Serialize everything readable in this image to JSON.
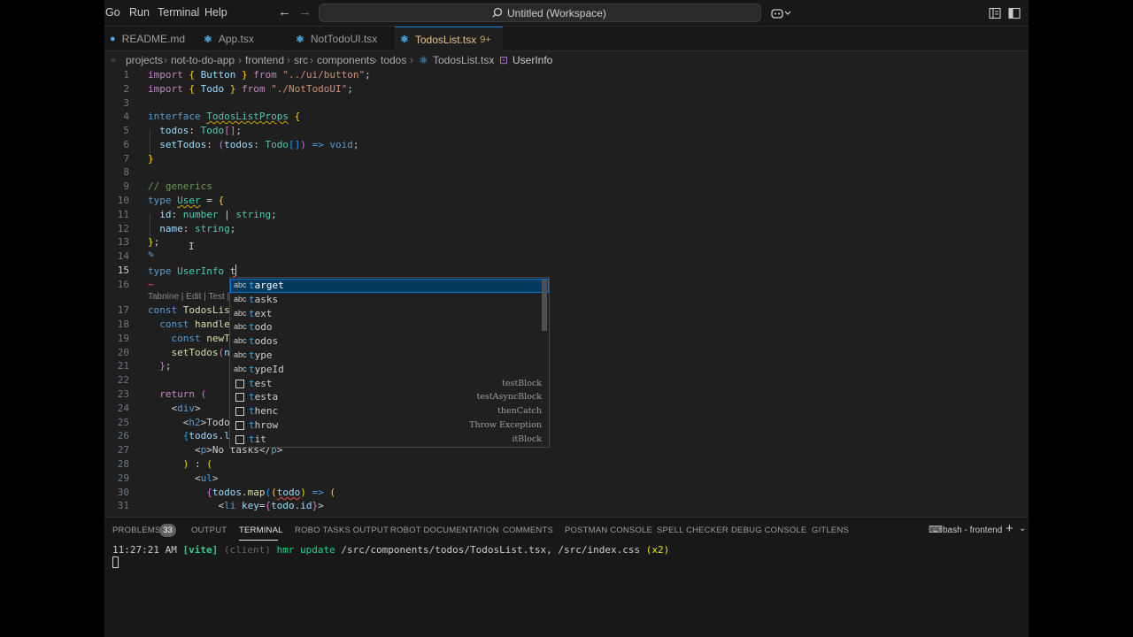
{
  "menu": [
    "Go",
    "Run",
    "Terminal",
    "Help"
  ],
  "command_center": "Untitled (Workspace)",
  "tabs": [
    {
      "label": "README.md",
      "icon": "info-icon",
      "color": "#4aa6e8"
    },
    {
      "label": "App.tsx",
      "icon": "react-icon",
      "color": "#4fc1ff"
    },
    {
      "label": "NotTodoUI.tsx",
      "icon": "react-icon",
      "color": "#4fc1ff"
    },
    {
      "label": "TodosList.tsx",
      "icon": "react-icon",
      "color": "#4fc1ff",
      "badge": "9+",
      "active": true,
      "dirty": true
    }
  ],
  "breadcrumb": [
    "projects",
    "not-to-do-app",
    "frontend",
    "src",
    "components",
    "todos",
    "TodosList.tsx",
    "UserInfo"
  ],
  "editor": {
    "line_numbers": [
      "1",
      "2",
      "3",
      "4",
      "5",
      "6",
      "7",
      "8",
      "9",
      "10",
      "11",
      "12",
      "13",
      "14",
      "15",
      "16",
      "17",
      "18",
      "19",
      "20",
      "21",
      "22",
      "23",
      "24",
      "25",
      "26",
      "27",
      "28",
      "29",
      "30",
      "31"
    ],
    "current_line": "15",
    "codelens": "Tabnine | Edit | Test | F"
  },
  "suggest": {
    "items": [
      {
        "kind": "abc",
        "match": "t",
        "rest": "arget",
        "detail": ""
      },
      {
        "kind": "abc",
        "match": "t",
        "rest": "asks",
        "detail": ""
      },
      {
        "kind": "abc",
        "match": "t",
        "rest": "ext",
        "detail": ""
      },
      {
        "kind": "abc",
        "match": "t",
        "rest": "odo",
        "detail": ""
      },
      {
        "kind": "abc",
        "match": "t",
        "rest": "odos",
        "detail": ""
      },
      {
        "kind": "abc",
        "match": "t",
        "rest": "ype",
        "detail": ""
      },
      {
        "kind": "abc",
        "match": "t",
        "rest": "ypeId",
        "detail": ""
      },
      {
        "kind": "snippet",
        "match": "t",
        "rest": "est",
        "detail": "testBlock"
      },
      {
        "kind": "snippet",
        "match": "t",
        "rest": "esta",
        "detail": "testAsyncBlock"
      },
      {
        "kind": "snippet",
        "match": "t",
        "rest": "henc",
        "detail": "thenCatch"
      },
      {
        "kind": "snippet",
        "match": "t",
        "rest": "hrow",
        "detail": "Throw Exception"
      },
      {
        "kind": "snippet",
        "match": "t",
        "rest": "it",
        "detail": "itBlock"
      }
    ]
  },
  "panel": {
    "tabs": [
      "PROBLEMS",
      "OUTPUT",
      "TERMINAL",
      "ROBO TASKS OUTPUT",
      "ROBOT DOCUMENTATION",
      "COMMENTS",
      "POSTMAN CONSOLE",
      "SPELL CHECKER",
      "DEBUG CONSOLE",
      "GITLENS"
    ],
    "active_tab": "TERMINAL",
    "problems_count": "33",
    "terminal_name": "bash - frontend",
    "terminal_line": {
      "time": "11:27:21 AM",
      "tag": "[vite]",
      "client": "(client)",
      "msg": "hmr update",
      "path": "/src/components/todos/TodosList.tsx, /src/index.css",
      "count": "(x2)"
    }
  }
}
